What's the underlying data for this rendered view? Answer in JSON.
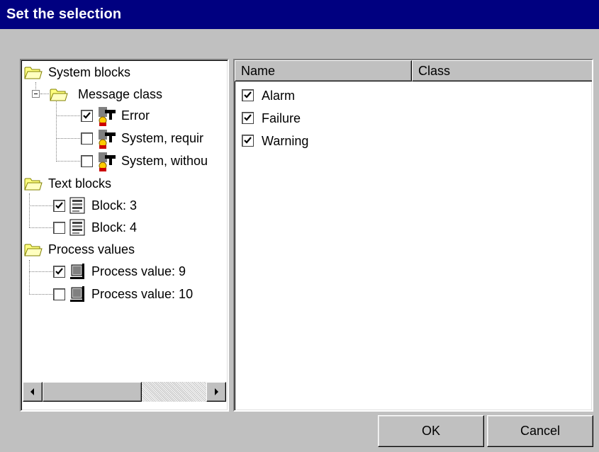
{
  "window": {
    "title": "Set the selection"
  },
  "tree": {
    "system_blocks": "System blocks",
    "message_class": "Message class",
    "error": {
      "label": "Error",
      "checked": true
    },
    "system_required": {
      "label": "System, requir",
      "checked": false
    },
    "system_without": {
      "label": "System, withou",
      "checked": false
    },
    "text_blocks": "Text blocks",
    "block3": {
      "label": "Block:  3",
      "checked": true
    },
    "block4": {
      "label": "Block:  4",
      "checked": false
    },
    "process_values": "Process values",
    "pv9": {
      "label": "Process value:  9",
      "checked": true
    },
    "pv10": {
      "label": "Process value: 10",
      "checked": false
    }
  },
  "list": {
    "col_name": "Name",
    "col_class": "Class",
    "rows": [
      {
        "label": "Alarm",
        "checked": true
      },
      {
        "label": "Failure",
        "checked": true
      },
      {
        "label": "Warning",
        "checked": true
      }
    ]
  },
  "buttons": {
    "ok": "OK",
    "cancel": "Cancel"
  }
}
